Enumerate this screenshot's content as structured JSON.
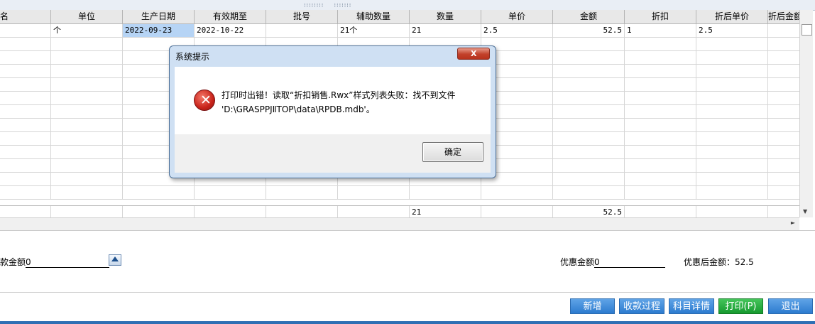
{
  "grid": {
    "columns": [
      {
        "label": "名",
        "w": 72
      },
      {
        "label": "单位",
        "w": 101
      },
      {
        "label": "生产日期",
        "w": 101
      },
      {
        "label": "有效期至",
        "w": 101
      },
      {
        "label": "批号",
        "w": 101
      },
      {
        "label": "辅助数量",
        "w": 101
      },
      {
        "label": "数量",
        "w": 101
      },
      {
        "label": "单价",
        "w": 101
      },
      {
        "label": "金额",
        "w": 101
      },
      {
        "label": "折扣",
        "w": 101
      },
      {
        "label": "折后单价",
        "w": 101
      },
      {
        "label": "折后金额",
        "w": 45
      }
    ],
    "row1": [
      "",
      "个",
      "2022-09-23",
      "2022-10-22",
      "",
      "21个",
      "21",
      "2.5",
      "52.5",
      "1",
      "2.5",
      ""
    ],
    "totals": [
      "",
      "",
      "",
      "",
      "",
      "",
      "21",
      "",
      "52.5",
      "",
      "",
      ""
    ]
  },
  "bottom": {
    "left_label": "款金额",
    "left_value": "0",
    "discount_label": "优惠金额",
    "discount_value": "0",
    "after_discount": "优惠后金额：52.5"
  },
  "buttons": {
    "add": "新增",
    "process": "收款过程",
    "detail": "科目详情",
    "print": "打印(P)",
    "exit": "退出"
  },
  "dialog": {
    "title": "系统提示",
    "close": "X",
    "message": "打印时出错！读取“折扣销售.Rwx”样式列表失败：找不到文件 'D:\\GRASPPJⅡTOP\\data\\RPDB.mdb'。",
    "ok": "确定"
  },
  "colors": {
    "selected_cell": "#b6d4f5",
    "button_blue": "#2c7bcf",
    "button_green": "#169a2f",
    "dialog_frame": "#cfe0f3"
  }
}
